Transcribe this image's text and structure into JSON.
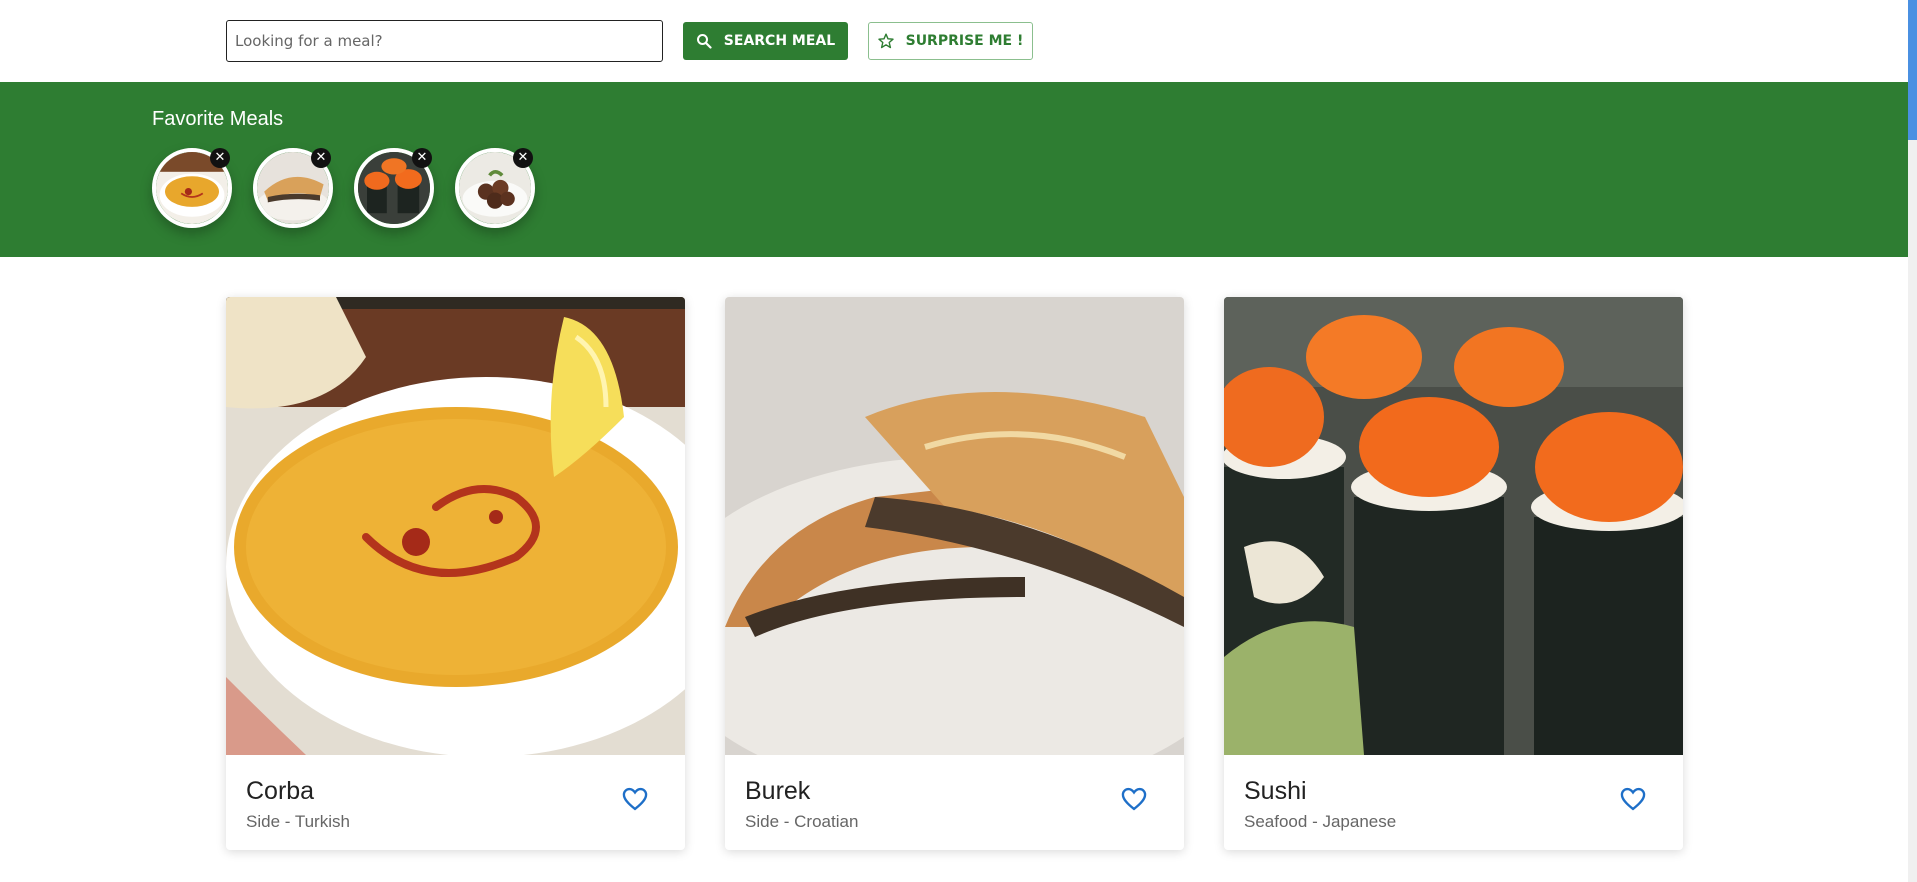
{
  "search": {
    "placeholder": "Looking for a meal?",
    "value": ""
  },
  "buttons": {
    "search_label": "SEARCH MEAL",
    "surprise_label": "SURPRISE ME !"
  },
  "favorites": {
    "title": "Favorite Meals",
    "remove_glyph": "✕",
    "items": [
      {
        "meal": "Corba"
      },
      {
        "meal": "Burek"
      },
      {
        "meal": "Sushi"
      },
      {
        "meal": "Meatballs"
      }
    ]
  },
  "meals": [
    {
      "name": "Corba",
      "category": "Side",
      "area": "Turkish",
      "separator": " - "
    },
    {
      "name": "Burek",
      "category": "Side",
      "area": "Croatian",
      "separator": " - "
    },
    {
      "name": "Sushi",
      "category": "Seafood",
      "area": "Japanese",
      "separator": " - "
    }
  ],
  "colors": {
    "brand": "#2e7d32",
    "heart": "#1e6fc8"
  },
  "icons": {
    "search": "search-icon",
    "surprise": "star-icon",
    "favorite": "heart-icon",
    "remove": "close-icon"
  }
}
